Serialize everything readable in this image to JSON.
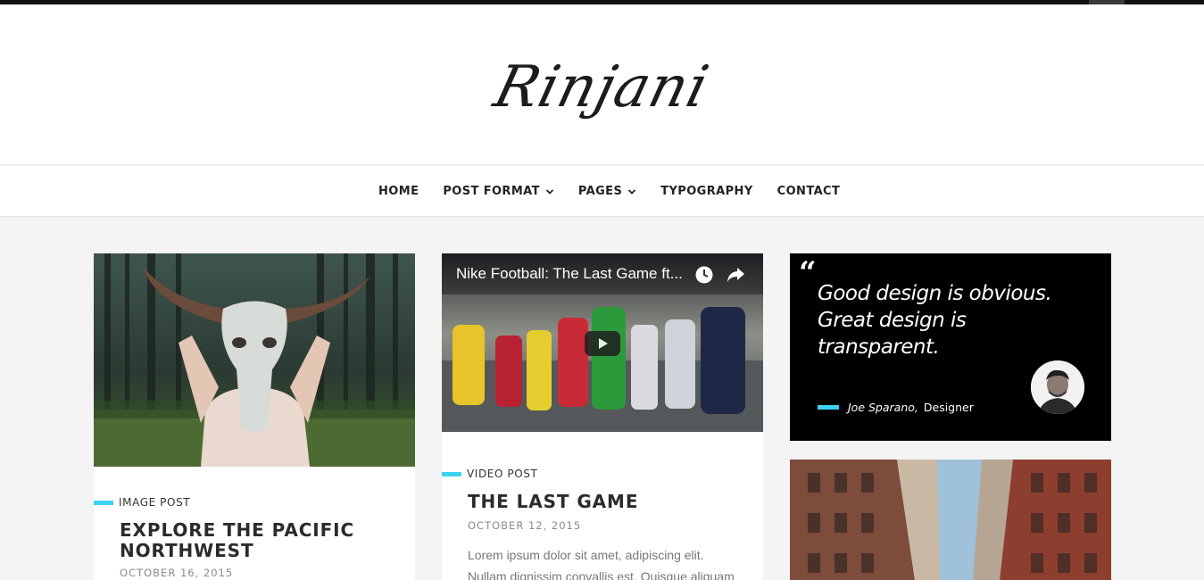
{
  "site": {
    "logo_text": "Rinjani"
  },
  "nav": {
    "items": [
      {
        "label": "HOME",
        "has_dropdown": false
      },
      {
        "label": "POST FORMAT",
        "has_dropdown": true
      },
      {
        "label": "PAGES",
        "has_dropdown": true
      },
      {
        "label": "TYPOGRAPHY",
        "has_dropdown": false
      },
      {
        "label": "CONTACT",
        "has_dropdown": false
      }
    ]
  },
  "posts": [
    {
      "format": "IMAGE POST",
      "title_line1": "EXPLORE THE PACIFIC",
      "title_line2": "NORTHWEST",
      "date": "OCTOBER 16, 2015"
    },
    {
      "format": "VIDEO POST",
      "video_title": "Nike Football: The Last Game ft...",
      "title": "THE LAST GAME",
      "date": "OCTOBER 12, 2015",
      "excerpt_line1": "Lorem ipsum dolor sit amet,  adipiscing elit.",
      "excerpt_line2": "Nullam dignissim convallis est. Quisque aliquam"
    }
  ],
  "quote": {
    "mark": "“",
    "line1": "Good design is obvious.",
    "line2": "Great design is",
    "line3": "transparent.",
    "author": "Joe Sparano,",
    "role": "Designer"
  },
  "colors": {
    "accent": "#3dd3f0",
    "dark": "#000000",
    "background": "#f4f4f4"
  }
}
